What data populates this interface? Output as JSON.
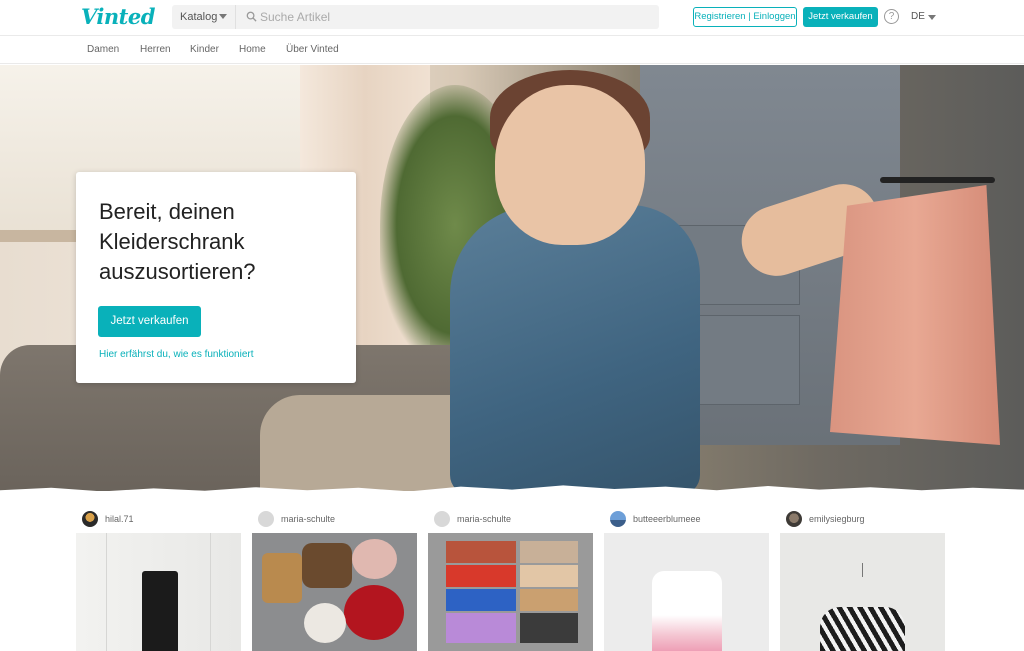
{
  "brand": {
    "logo": "Vinted",
    "accent": "#09b1ba"
  },
  "header": {
    "catalog_label": "Katalog",
    "search_placeholder": "Suche Artikel",
    "register_login_label": "Registrieren | Einloggen",
    "sell_label": "Jetzt verkaufen",
    "help_label": "?",
    "language": "DE"
  },
  "nav": {
    "items": [
      "Damen",
      "Herren",
      "Kinder",
      "Home",
      "Über Vinted"
    ]
  },
  "hero": {
    "title": "Bereit, deinen Kleiderschrank auszusortieren?",
    "cta_label": "Jetzt verkaufen",
    "link_label": "Hier erfährst du, wie es funktioniert"
  },
  "feed": {
    "items": [
      {
        "user": "hilal.71"
      },
      {
        "user": "maria-schulte"
      },
      {
        "user": "maria-schulte"
      },
      {
        "user": "butteeerblumeee"
      },
      {
        "user": "emilysiegburg"
      }
    ]
  }
}
